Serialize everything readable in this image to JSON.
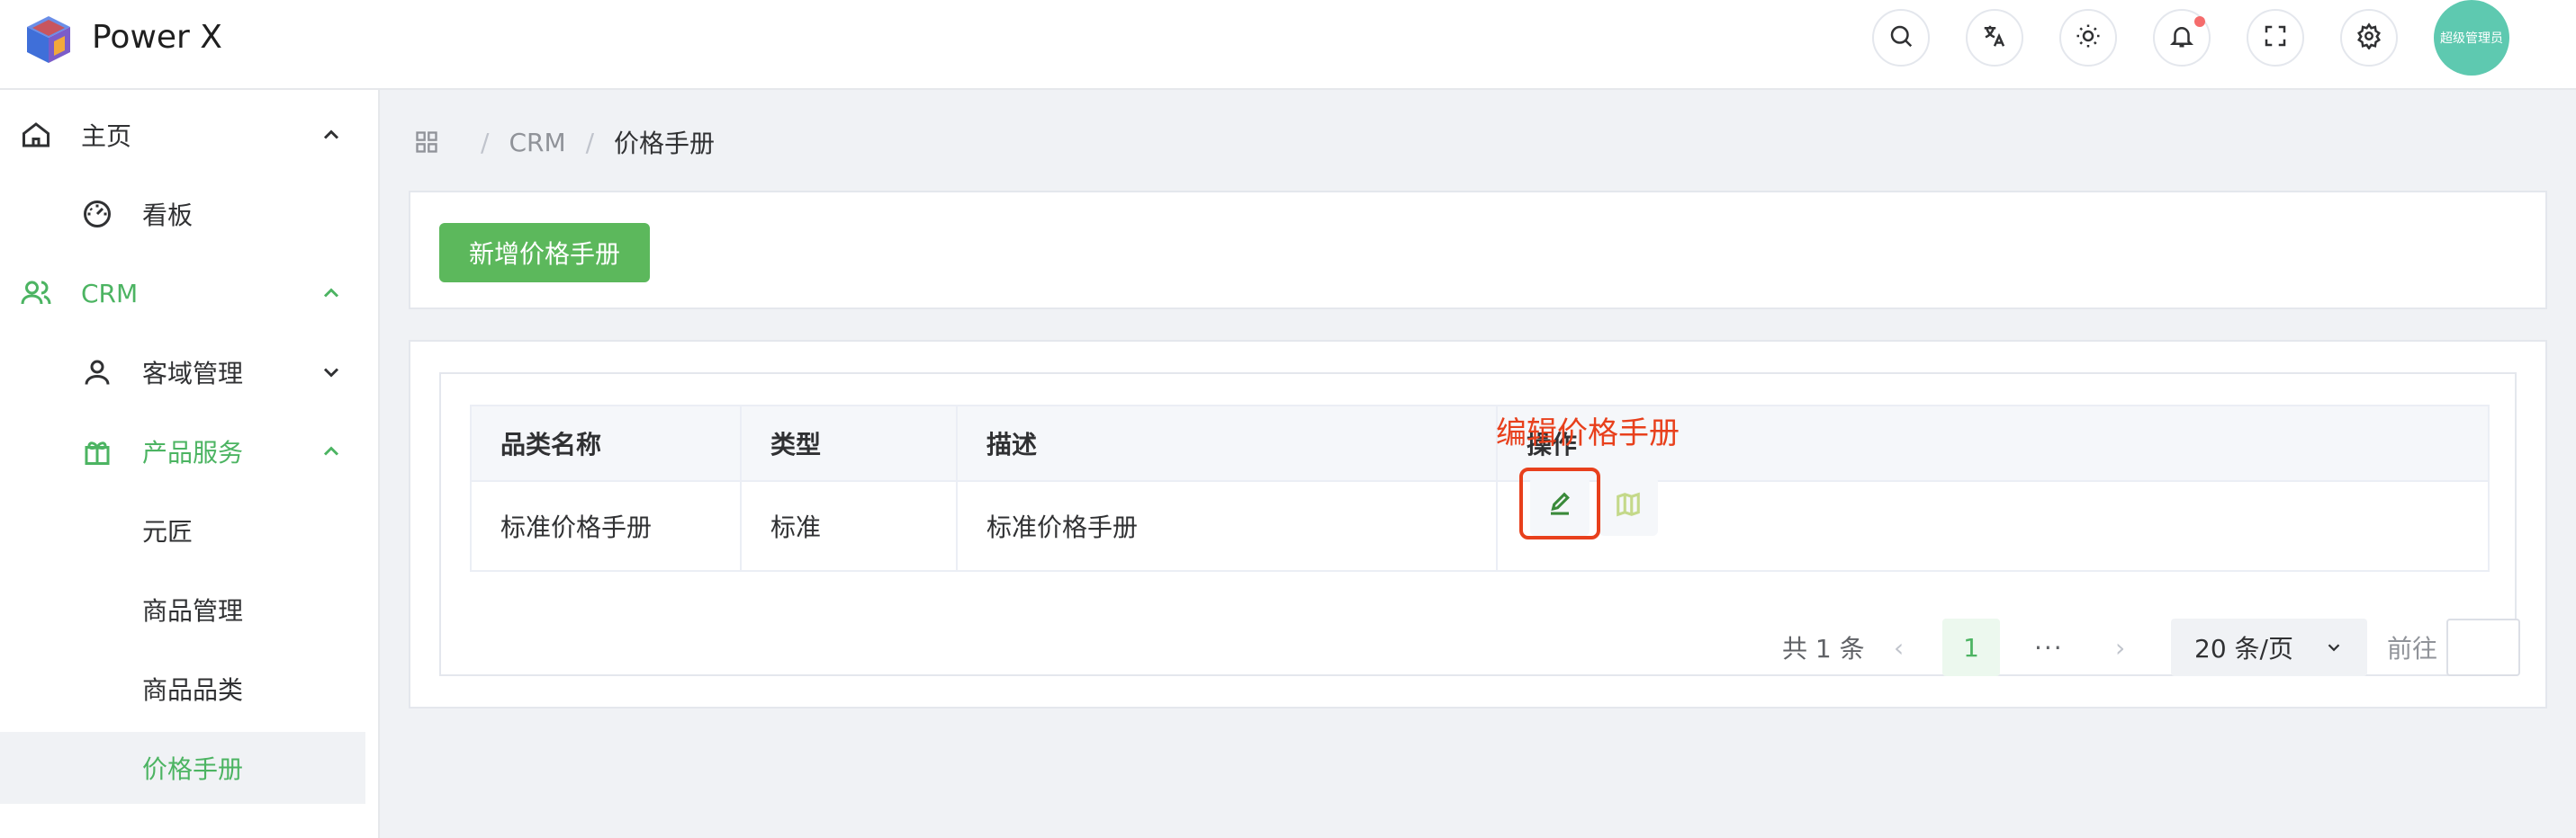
{
  "header": {
    "title": "Power X",
    "icons": [
      "search-icon",
      "translate-icon",
      "theme-icon",
      "bell-icon",
      "fullscreen-icon",
      "gear-icon"
    ],
    "avatar_text": "超级管理员"
  },
  "sidebar": {
    "items": [
      {
        "label": "主页",
        "icon": "home-icon"
      },
      {
        "label": "看板",
        "icon": "dashboard-icon"
      },
      {
        "label": "CRM",
        "icon": "users-icon"
      },
      {
        "label": "客域管理",
        "icon": "user-icon"
      },
      {
        "label": "产品服务",
        "icon": "gift-icon"
      },
      {
        "label": "元匠"
      },
      {
        "label": "商品管理"
      },
      {
        "label": "商品品类"
      },
      {
        "label": "价格手册"
      }
    ]
  },
  "breadcrumb": {
    "items": [
      "CRM",
      "价格手册"
    ]
  },
  "toolbar": {
    "add_label": "新增价格手册"
  },
  "table": {
    "columns": [
      "品类名称",
      "类型",
      "描述",
      "操作"
    ],
    "rows": [
      {
        "name": "标准价格手册",
        "type": "标准",
        "desc": "标准价格手册"
      }
    ]
  },
  "annotation": "编辑价格手册",
  "pagination": {
    "total": "共 1 条",
    "current": "1",
    "more": "···",
    "page_size": "20 条/页",
    "goto": "前往"
  },
  "colors": {
    "accent": "#4cb462",
    "button": "#5cb85c",
    "annotation": "#e8401c",
    "avatar": "#5ec9b0"
  }
}
